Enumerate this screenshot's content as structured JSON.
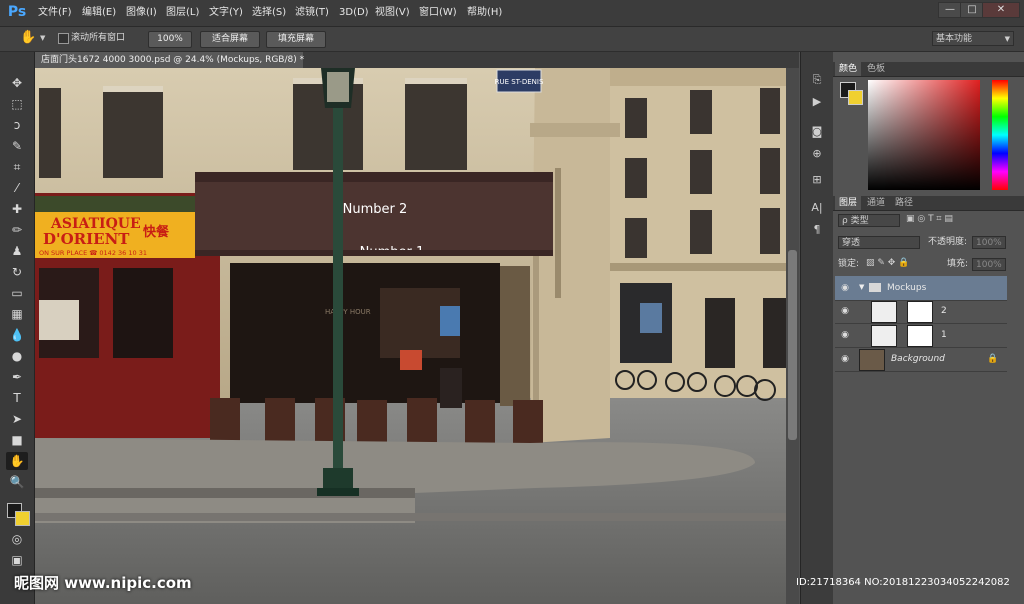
{
  "app": {
    "logo": "Ps"
  },
  "menu": [
    "文件(F)",
    "编辑(E)",
    "图像(I)",
    "图层(L)",
    "文字(Y)",
    "选择(S)",
    "滤镜(T)",
    "3D(D)",
    "视图(V)",
    "窗口(W)",
    "帮助(H)"
  ],
  "window_controls": [
    "—",
    "□",
    "✕"
  ],
  "options": {
    "scroll_all_label": "滚动所有窗口",
    "zoom_btn": "100%",
    "fit_btn": "适合屏幕",
    "fill_btn": "填充屏幕",
    "workspace": "基本功能"
  },
  "document": {
    "tab_title": "店面门头1672 4000 3000.psd @ 24.4% (Mockups, RGB/8) *",
    "sign_text": "ASIATIQUE",
    "sign_text2": "D'ORIENT",
    "sign_chinese": "快餐",
    "sign_sub": "ON SUR PLACE ☎ 0142 36 10 31",
    "awning_top": "Number 2",
    "awning_bottom": "Number 1",
    "street_sign": "RUE ST-DENIS",
    "cafe_window": "HAPPY HOUR"
  },
  "color_panel": {
    "tabs": [
      "颜色",
      "色板"
    ],
    "fg_color": "#1a1a1a",
    "bg_color": "#f0d030",
    "hue": "#e02020"
  },
  "layers_panel": {
    "tabs": [
      "图层",
      "通道",
      "路径"
    ],
    "filter_kind": "ρ 类型",
    "blend_mode": "穿透",
    "opacity_label": "不透明度:",
    "opacity_value": "100%",
    "lock_label": "锁定:",
    "fill_label": "填充:",
    "fill_value": "100%",
    "layers": [
      {
        "name": "Mockups",
        "type": "group"
      },
      {
        "name": "1",
        "type": "smart"
      },
      {
        "name": "2",
        "type": "smart"
      },
      {
        "name": "Background",
        "type": "background"
      }
    ]
  },
  "watermark": {
    "site": "昵图网 www.nipic.com",
    "id": "ID:21718364 NO:20181223034052242082"
  }
}
